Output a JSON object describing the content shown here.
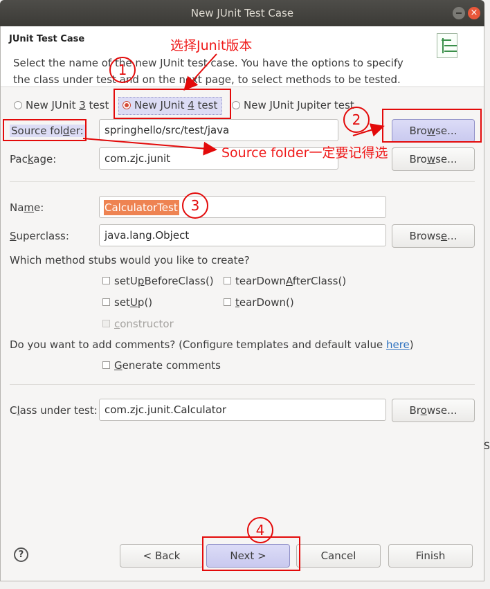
{
  "window": {
    "title": "New JUnit Test Case"
  },
  "header": {
    "title": "JUnit Test Case",
    "description": "Select the name of the new JUnit test case. You have the options to specify the class under test and on the next page, to select methods to be tested."
  },
  "version_radios": [
    {
      "label_pre": "New JUnit ",
      "mnemonic": "3",
      "label_post": " test",
      "selected": false
    },
    {
      "label_pre": "New JUnit ",
      "mnemonic": "4",
      "label_post": " test",
      "selected": true
    },
    {
      "label_pre": "New JUnit ",
      "mnemonic": "J",
      "label_post": "upiter test",
      "selected": false
    }
  ],
  "source_folder": {
    "label_pre": "Source fol",
    "mnemonic": "d",
    "label_post": "er:",
    "value": "springhello/src/test/java",
    "browse_pre": "Bro",
    "browse_m": "w",
    "browse_post": "se..."
  },
  "package": {
    "label_pre": "Pac",
    "mnemonic": "k",
    "label_post": "age:",
    "value": "com.zjc.junit",
    "browse_pre": "Bro",
    "browse_m": "w",
    "browse_post": "se..."
  },
  "name": {
    "label_pre": "Na",
    "mnemonic": "m",
    "label_post": "e:",
    "value": "CalculatorTest"
  },
  "superclass": {
    "label_pre": "",
    "mnemonic": "S",
    "label_post": "uperclass:",
    "value": "java.lang.Object",
    "browse_pre": "Brows",
    "browse_m": "e",
    "browse_post": "..."
  },
  "stubs": {
    "question": "Which method stubs would you like to create?",
    "setUpBeforeClass": {
      "pre": "setU",
      "m": "p",
      "post": "BeforeClass()",
      "checked": false
    },
    "tearDownAfterClass": {
      "pre": "tearDown",
      "m": "A",
      "post": "fterClass()",
      "checked": false
    },
    "setUp": {
      "pre": "set",
      "m": "U",
      "post": "p()",
      "checked": false
    },
    "tearDown": {
      "pre": "",
      "m": "t",
      "post": "earDown()",
      "checked": false
    },
    "constructor": {
      "pre": "",
      "m": "c",
      "post": "onstructor",
      "checked": false,
      "disabled": true
    }
  },
  "comments": {
    "question": "Do you want to add comments? (Configure templates and default value ",
    "link": "here",
    "question_end": ")",
    "generate": {
      "pre": "",
      "m": "G",
      "post": "enerate comments",
      "checked": false
    }
  },
  "class_under_test": {
    "label_pre": "C",
    "mnemonic": "l",
    "label_post": "ass under test:",
    "value": "com.zjc.junit.Calculator",
    "browse_pre": "Br",
    "browse_m": "o",
    "browse_post": "wse..."
  },
  "footer": {
    "help": "?",
    "back": "< Back",
    "next": "Next >",
    "cancel": "Cancel",
    "finish": "Finish"
  },
  "annotations": {
    "junit_version_note": "选择Junit版本",
    "source_folder_note": "Source folder一定要记得选",
    "markers": [
      "1",
      "2",
      "3",
      "4"
    ],
    "color": "#e30a0a"
  },
  "background": {
    "glyphs": [
      "e",
      "S",
      "["
    ]
  }
}
